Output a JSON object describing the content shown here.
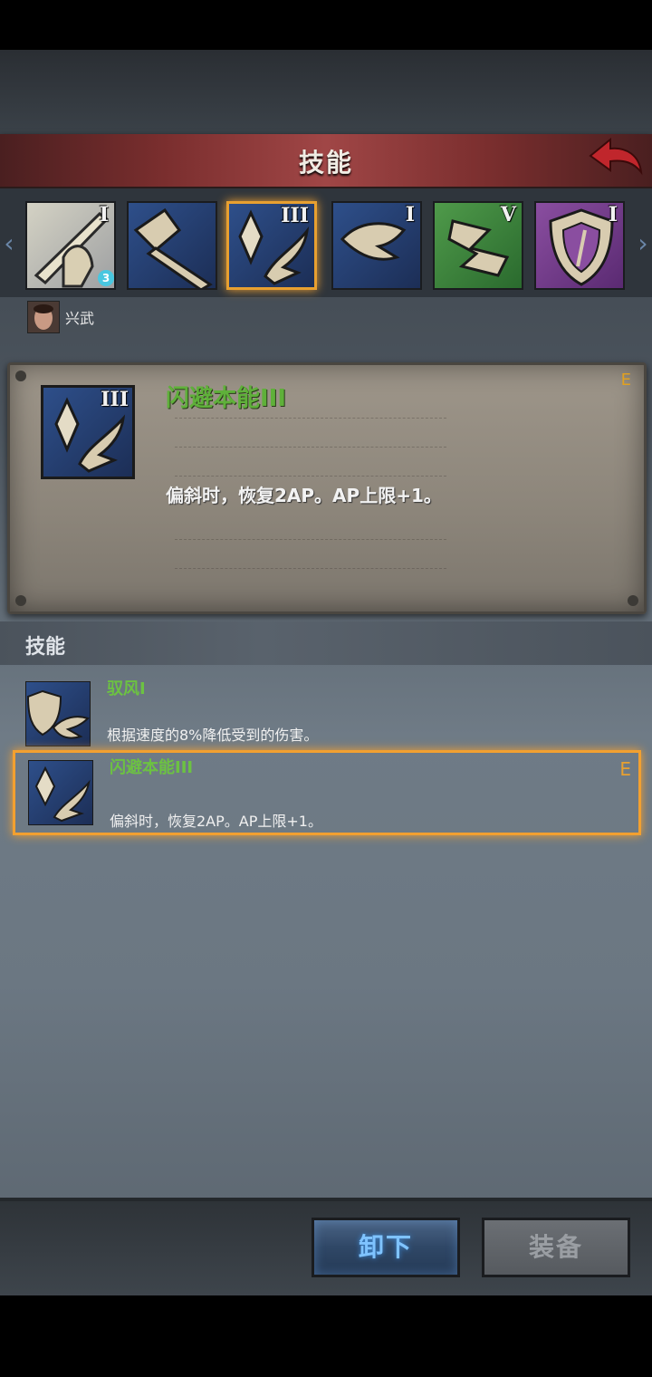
{
  "header": {
    "title": "技能"
  },
  "skill_slots": [
    {
      "rank": "I",
      "badge": "3",
      "icon": "sword-slash-icon"
    },
    {
      "rank": "",
      "icon": "hammer-strike-icon"
    },
    {
      "rank": "III",
      "icon": "crystal-dodge-icon",
      "selected": true
    },
    {
      "rank": "I",
      "icon": "wind-claw-icon"
    },
    {
      "rank": "V",
      "icon": "green-claw-icon"
    },
    {
      "rank": "I",
      "icon": "shield-icon"
    }
  ],
  "character": {
    "name": "兴武"
  },
  "detail": {
    "rank": "III",
    "name": "闪避本能III",
    "grade": "E",
    "description": "偏斜时，恢复2AP。AP上限+1。"
  },
  "section": {
    "title": "技能"
  },
  "skills_list": [
    {
      "name": "驭风I",
      "description": "根据速度的8%降低受到的伤害。",
      "grade": "",
      "icon": "shield-wind-icon"
    },
    {
      "name": "闪避本能III",
      "description": "偏斜时，恢复2AP。AP上限+1。",
      "grade": "E",
      "icon": "crystal-dodge-icon",
      "selected": true
    }
  ],
  "buttons": {
    "unequip": "卸下",
    "equip": "装备"
  },
  "colors": {
    "accent": "#f2a030",
    "skill_name": "#6cc242",
    "header_red": "#a04646"
  }
}
